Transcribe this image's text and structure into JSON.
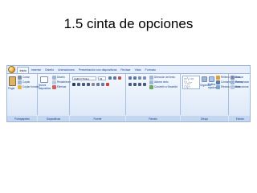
{
  "slide": {
    "title": "1.5 cinta de opciones"
  },
  "ribbon": {
    "tabs": [
      {
        "label": "Inicio",
        "active": true
      },
      {
        "label": "Insertar"
      },
      {
        "label": "Diseño"
      },
      {
        "label": "Animaciones"
      },
      {
        "label": "Presentación con diapositivas"
      },
      {
        "label": "Revisar"
      },
      {
        "label": "Vista"
      },
      {
        "label": "Formato"
      }
    ],
    "groups": {
      "portapapeles": {
        "label": "Portapapeles",
        "paste": "Pegar",
        "cut": "Cortar",
        "copy": "Copiar",
        "format_painter": "Copiar formato"
      },
      "diapositivas": {
        "label": "Diapositivas",
        "new_slide": "Nueva diapositiva",
        "design": "Diseño",
        "reset": "Restablecer",
        "delete": "Eliminar"
      },
      "fuente": {
        "label": "Fuente",
        "font_name": "Calibri (Título)",
        "font_size": "44"
      },
      "parrafo": {
        "label": "Párrafo",
        "text_direction": "Dirección del texto",
        "align_text": "Alinear texto",
        "smartart": "Convertir a SmartArt"
      },
      "dibujo": {
        "label": "Dibujo",
        "arrange": "Organizar",
        "quick_styles": "Estilos rápidos",
        "shape_fill": "Relleno de forma",
        "shape_outline": "Contorno de forma",
        "shape_effects": "Efectos de forma"
      },
      "edicion": {
        "label": "Edición",
        "find": "Buscar",
        "replace": "Reemplazar",
        "select": "Seleccionar"
      }
    }
  },
  "colors": {
    "ribbon_bg": "#e6eefb",
    "ribbon_border": "#9db5d8",
    "label_text": "#15428b"
  }
}
